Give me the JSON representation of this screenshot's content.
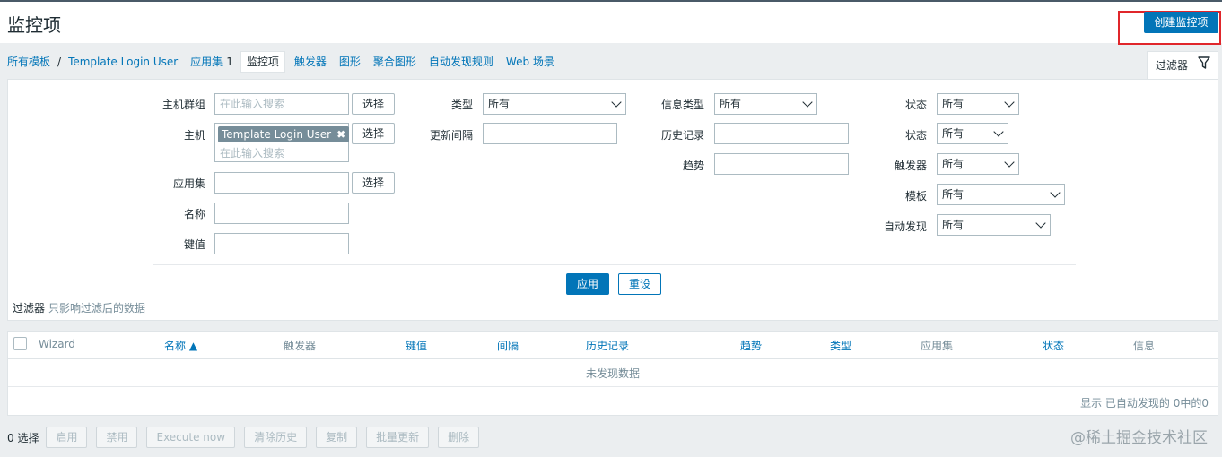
{
  "header": {
    "title": "监控项",
    "create_button": "创建监控项"
  },
  "nav": {
    "all_templates": "所有模板",
    "separator": "/",
    "template_name": "Template Login User",
    "applications": "应用集",
    "applications_count": "1",
    "items": "监控项",
    "triggers": "触发器",
    "graphs": "图形",
    "screens": "聚合图形",
    "discovery": "自动发现规则",
    "web": "Web 场景"
  },
  "filter_tab": {
    "label": "过滤器"
  },
  "filter": {
    "host_group_label": "主机群组",
    "host_group_placeholder": "在此输入搜索",
    "select_label": "选择",
    "host_label": "主机",
    "host_chip": "Template Login User",
    "host_placeholder": "在此输入搜索",
    "application_label": "应用集",
    "name_label": "名称",
    "key_label": "键值",
    "type_label": "类型",
    "type_value": "所有",
    "interval_label": "更新间隔",
    "info_type_label": "信息类型",
    "info_type_value": "所有",
    "history_label": "历史记录",
    "trends_label": "趋势",
    "state_label": "状态",
    "state_value": "所有",
    "status_label": "状态",
    "status_value": "所有",
    "triggers_label": "触发器",
    "triggers_value": "所有",
    "template_label": "模板",
    "template_value": "所有",
    "discovery_label": "自动发现",
    "discovery_value": "所有",
    "apply_button": "应用",
    "reset_button": "重设",
    "note_title": "过滤器",
    "note_text": "只影响过滤后的数据"
  },
  "table": {
    "columns": [
      "Wizard",
      "名称 ▲",
      "触发器",
      "键值",
      "间隔",
      "历史记录",
      "趋势",
      "类型",
      "应用集",
      "状态",
      "信息"
    ],
    "empty_text": "未发现数据",
    "footer": "显示 已自动发现的 0中的0"
  },
  "actions": {
    "selected": "0 选择",
    "enable": "启用",
    "disable": "禁用",
    "execute_now": "Execute now",
    "clear_history": "清除历史",
    "copy": "复制",
    "mass_update": "批量更新",
    "delete": "删除"
  },
  "watermark": "@稀土掘金技术社区"
}
